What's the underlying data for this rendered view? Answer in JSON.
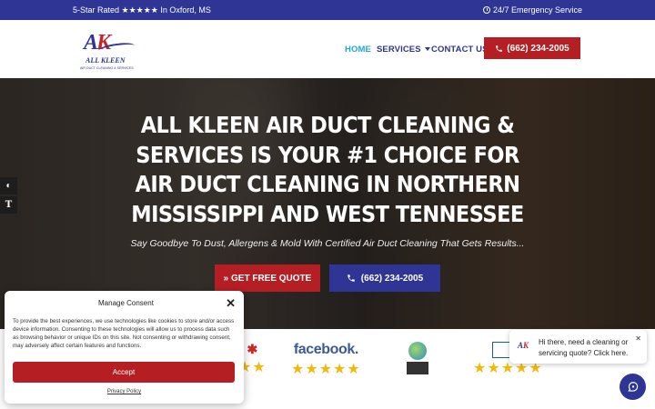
{
  "topbar": {
    "rating": "5-Star Rated ★★★★★ In Oxford, MS",
    "emergency": "24/7 Emergency Service"
  },
  "logo": {
    "mark_a": "A",
    "mark_k": "K",
    "name": "ALL KLEEN",
    "tagline": "AIR DUCT CLEANING & SERVICES"
  },
  "nav": {
    "home": "HOME",
    "services": "SERVICES",
    "contact": "CONTACT US",
    "phone": "(662) 234-2005"
  },
  "hero": {
    "headline": "ALL KLEEN AIR DUCT CLEANING & SERVICES IS YOUR #1 CHOICE FOR AIR DUCT CLEANING IN NORTHERN MISSISSIPPI AND WEST TENNESSEE",
    "subheadline": "Say Goodbye To Dust, Allergens & Mold With Certified Air Duct Cleaning That Gets Results...",
    "quote_button": "» GET FREE QUOTE",
    "call_button": "(662) 234-2005"
  },
  "reviews": {
    "facebook": "facebook.",
    "stars": "★★★★★",
    "partial_stars": "★★"
  },
  "cookie": {
    "title": "Manage Consent",
    "close": "✕",
    "body": "To provide the best experiences, we use technologies like cookies to store and/or access device information. Consenting to these technologies will allow us to process data such as browsing behavior or unique IDs on this site. Not consenting or withdrawing consent, may adversely affect certain features and functions.",
    "accept": "Accept",
    "policy": "Privacy Policy"
  },
  "chat": {
    "message": "Hi there, need a cleaning or servicing quote? Click here.",
    "close": "✕"
  },
  "colors": {
    "navy": "#2e3594",
    "red": "#b51f24",
    "active_link": "#23a7d6",
    "star": "#f2b90d"
  },
  "icons": [
    "clock-icon",
    "phone-icon",
    "caret-down-icon",
    "contrast-icon",
    "text-size-icon",
    "chat-icon",
    "close-icon"
  ]
}
